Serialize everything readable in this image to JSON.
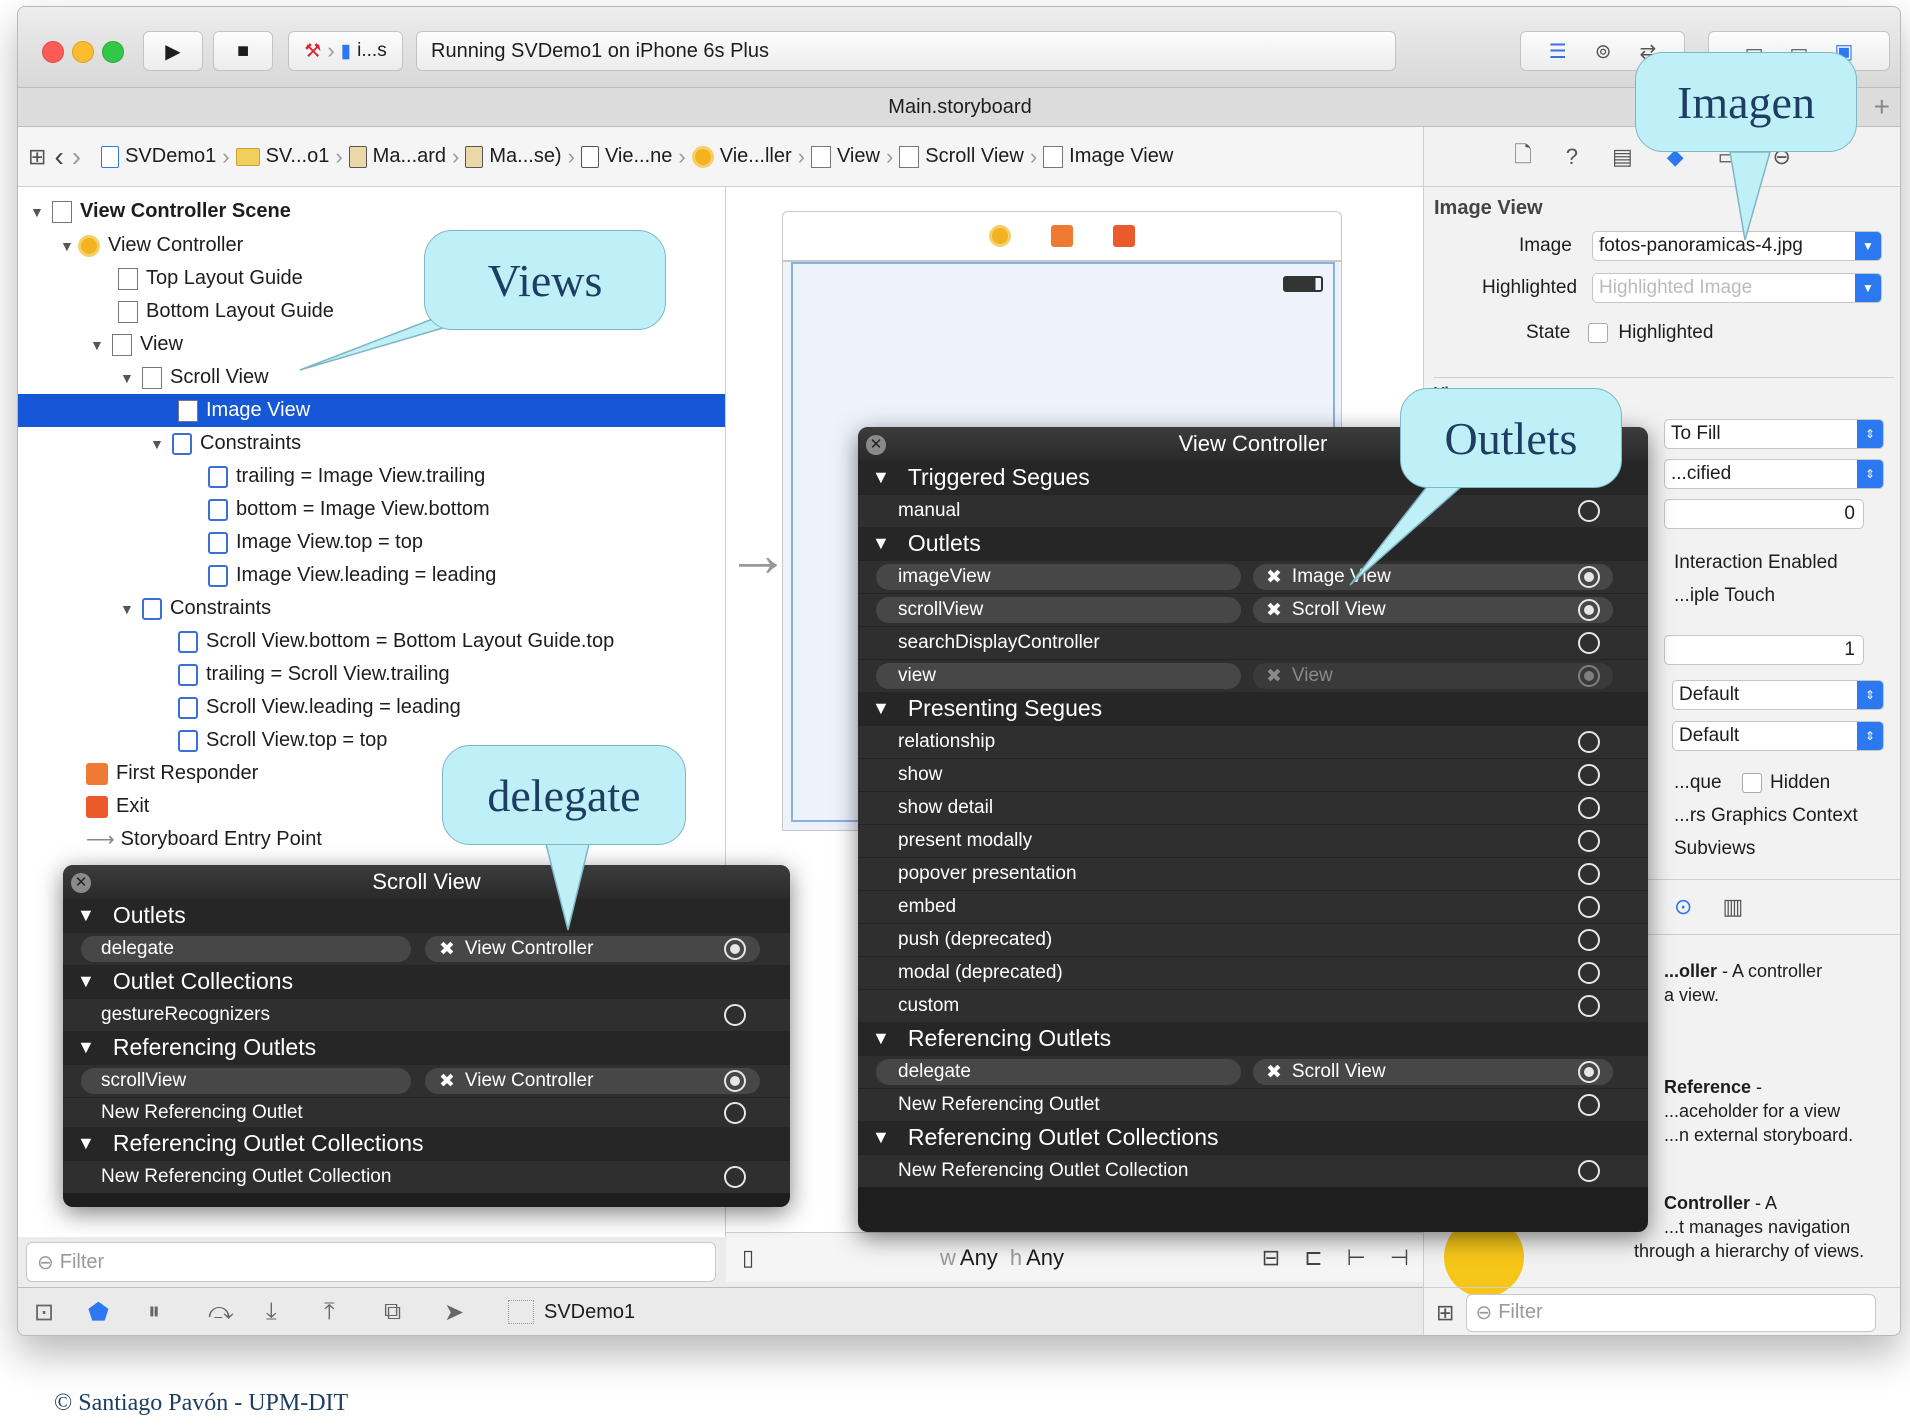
{
  "toolbar": {
    "scheme_short": "i...s",
    "status": "Running SVDemo1 on iPhone 6s Plus"
  },
  "title_bar": {
    "filename": "Main.storyboard"
  },
  "breadcrumb": [
    "SVDemo1",
    "SV...o1",
    "Ma...ard",
    "Ma...se)",
    "Vie...ne",
    "Vie...ller",
    "View",
    "Scroll View",
    "Image View"
  ],
  "outline": {
    "scene": "View Controller Scene",
    "vc": "View Controller",
    "top_guide": "Top Layout Guide",
    "bottom_guide": "Bottom Layout Guide",
    "view": "View",
    "scroll": "Scroll View",
    "image": "Image View",
    "constraints": "Constraints",
    "c1": "trailing = Image View.trailing",
    "c2": "bottom = Image View.bottom",
    "c3": "Image View.top = top",
    "c4": "Image View.leading = leading",
    "constraints2": "Constraints",
    "d1": "Scroll View.bottom = Bottom Layout Guide.top",
    "d2": "trailing = Scroll View.trailing",
    "d3": "Scroll View.leading = leading",
    "d4": "Scroll View.top = top",
    "first_responder": "First Responder",
    "exit": "Exit",
    "entry": "Storyboard Entry Point",
    "filter": "Filter"
  },
  "scroll_hud": {
    "title": "Scroll View",
    "outlets": "Outlets",
    "delegate": "delegate",
    "delegate_target": "View Controller",
    "outlet_collections": "Outlet Collections",
    "gesture": "gestureRecognizers",
    "ref_outlets": "Referencing Outlets",
    "scrollview": "scrollView",
    "scrollview_target": "View Controller",
    "new_ref": "New Referencing Outlet",
    "ref_collections": "Referencing Outlet Collections",
    "new_ref_coll": "New Referencing Outlet Collection"
  },
  "vc_hud": {
    "title": "View Controller",
    "triggered": "Triggered Segues",
    "manual": "manual",
    "outlets": "Outlets",
    "imageView": "imageView",
    "imageView_target": "Image View",
    "scrollView": "scrollView",
    "scrollView_target": "Scroll View",
    "sdc": "searchDisplayController",
    "view": "view",
    "view_target": "View",
    "presenting": "Presenting Segues",
    "relationship": "relationship",
    "show": "show",
    "show_detail": "show detail",
    "present_modally": "present modally",
    "popover": "popover presentation",
    "embed": "embed",
    "push": "push (deprecated)",
    "modal": "modal (deprecated)",
    "custom": "custom",
    "ref_outlets": "Referencing Outlets",
    "delegate": "delegate",
    "delegate_target": "Scroll View",
    "new_ref": "New Referencing Outlet",
    "ref_collections": "Referencing Outlet Collections",
    "new_ref_coll": "New Referencing Outlet Collection"
  },
  "canvas": {
    "size_w": "w",
    "size_any": "Any",
    "size_h": "h",
    "size_any2": "Any"
  },
  "inspector": {
    "section": "Image View",
    "image_label": "Image",
    "image_value": "fotos-panoramicas-4.jpg",
    "highlighted_label": "Highlighted",
    "highlighted_placeholder": "Highlighted Image",
    "state_label": "State",
    "state_check": "Highlighted",
    "view_hdr": "View",
    "mode": "To Fill",
    "semantic": "...cified",
    "tag": "0",
    "interaction": "Interaction Enabled",
    "multiple": "...iple Touch",
    "alpha": "1",
    "bg": "Default",
    "tint": "Default",
    "opaque": "...que",
    "hidden": "Hidden",
    "clears": "...rs Graphics Context",
    "clip": "Subviews",
    "filter": "Filter"
  },
  "library": [
    {
      "title": "...oller",
      "desc_a": " - A controller",
      "desc_b": "a view."
    },
    {
      "title": "Reference",
      "desc_a": " -",
      "desc_b": "...aceholder for a view",
      "desc_c": "...n external storyboard."
    },
    {
      "title": "Controller",
      "desc_a": " - A",
      "desc_b": "...t manages navigation",
      "desc_c": "through a hierarchy of views."
    }
  ],
  "bottom_bar": {
    "scheme": "SVDemo1"
  },
  "callouts": {
    "imagen": "Imagen",
    "views": "Views",
    "outlets": "Outlets",
    "delegate": "delegate"
  },
  "copyright": "© Santiago Pavón - UPM-DIT",
  "colors": {
    "selection": "#1557d6",
    "accent": "#2b78f0",
    "hud_bg": "#1e1e1e",
    "callout": "#bff0f7"
  }
}
